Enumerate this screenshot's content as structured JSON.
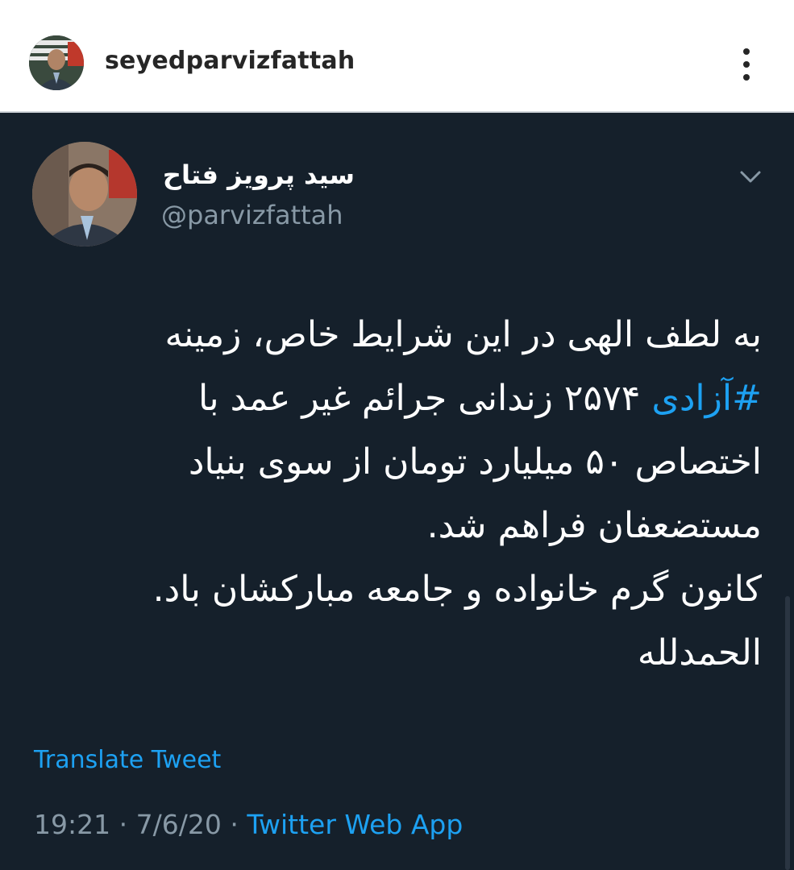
{
  "instagram": {
    "username": "seyedparvizfattah",
    "avatar_icon": "profile-photo",
    "more_icon": "vertical-dots-icon"
  },
  "tweet": {
    "display_name": "سید پرویز فتاح",
    "handle": "@parvizfattah",
    "caret_icon": "chevron-down-icon",
    "body": {
      "line1": "به لطف الهی در این شرایط خاص، زمینه",
      "hashtag": "#آزادی",
      "line2_rest": " ۲۵۷۴ زندانی جرائم غیر عمد با",
      "line3": "اختصاص ۵۰ میلیارد تومان از سوی بنیاد",
      "line4": "مستضعفان فراهم شد.",
      "line5": "کانون گرم خانواده و جامعه مبارکشان باد.",
      "line6": "الحمدلله"
    },
    "translate_label": "Translate Tweet",
    "time": "19:21",
    "date": "7/6/20",
    "separator": "·",
    "source": "Twitter Web App"
  },
  "colors": {
    "tweet_background": "#15202b",
    "link_blue": "#1da1f2",
    "muted_gray": "#8899a6"
  }
}
